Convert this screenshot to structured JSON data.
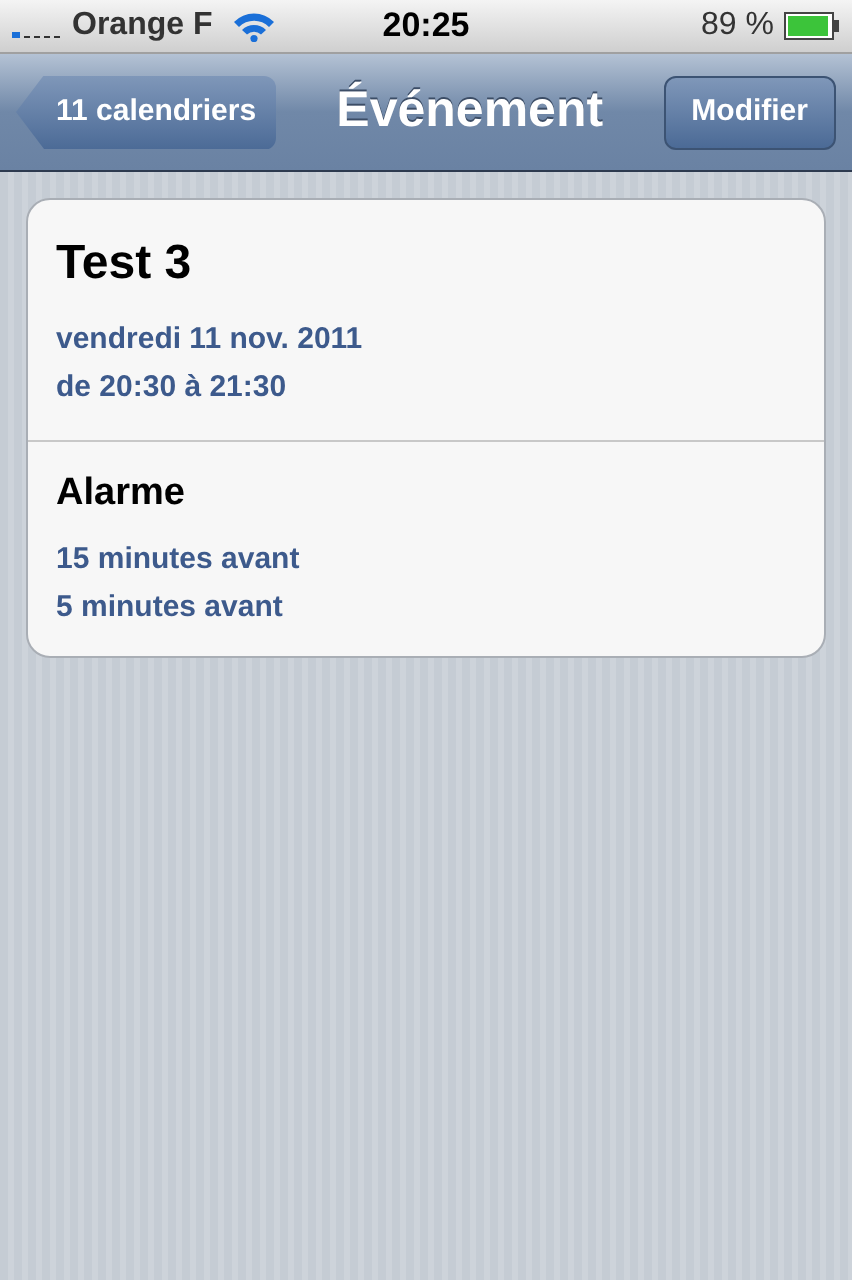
{
  "status_bar": {
    "carrier": "Orange F",
    "time": "20:25",
    "battery": "89 %"
  },
  "nav_bar": {
    "back": "11 calendriers",
    "title": "Événement",
    "action": "Modifier"
  },
  "sections": [
    {
      "kind": "event",
      "title": "Test 3",
      "lines": [
        "vendredi 11 nov. 2011",
        "de 20:30 à 21:30"
      ]
    },
    {
      "kind": "alarm",
      "title": "Alarme",
      "lines": [
        "15 minutes avant",
        "5 minutes avant"
      ]
    }
  ]
}
